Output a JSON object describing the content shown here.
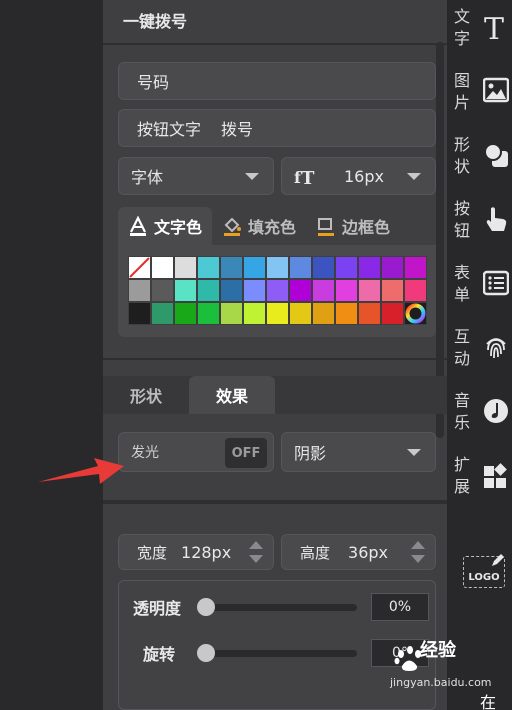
{
  "section": {
    "title": "一键拨号"
  },
  "phone_field": {
    "label": "号码"
  },
  "button_text": {
    "label": "按钮文字",
    "value": "拨号"
  },
  "font_select": {
    "value": "字体"
  },
  "font_size": {
    "value": "16px"
  },
  "color_tabs": [
    {
      "label": "文字色",
      "icon": "text-color-icon",
      "active": true
    },
    {
      "label": "填充色",
      "icon": "fill-bucket-icon",
      "active": false
    },
    {
      "label": "边框色",
      "icon": "border-color-icon",
      "active": false
    }
  ],
  "palette": [
    [
      "none",
      "#ffffff",
      "#dddddd",
      "#4cc9d2",
      "#3a87b8",
      "#35a5e6",
      "#82c4f2",
      "#5d8ae0",
      "#3c54c0",
      "#7a42f0",
      "#8a28e8",
      "#9a1ad0",
      "#c214c8"
    ],
    [
      "#9b9b9b",
      "#5a5a5a",
      "#5ae2c4",
      "#2fb9a8",
      "#2c6fa6",
      "#7b8cff",
      "#8f5cf5",
      "#b000d8",
      "#c93ce0",
      "#e23fe0",
      "#ee6aa8",
      "#ee6c6c",
      "#f03a7c"
    ],
    [
      "#1e1e1e",
      "#2e9a6a",
      "#18a818",
      "#1cbf3c",
      "#a8d848",
      "#bef232",
      "#e8ec1c",
      "#e4c816",
      "#e0a014",
      "#ef8e12",
      "#e8542a",
      "#d8202a",
      "more"
    ]
  ],
  "sub_tabs": [
    {
      "label": "形状",
      "active": false
    },
    {
      "label": "效果",
      "active": true
    }
  ],
  "glow": {
    "label": "发光",
    "toggle": "OFF"
  },
  "shadow_select": {
    "value": "阴影"
  },
  "width": {
    "label": "宽度",
    "value": "128px"
  },
  "height": {
    "label": "高度",
    "value": "36px"
  },
  "opacity": {
    "label": "透明度",
    "value": "0%",
    "level": 0
  },
  "rotation": {
    "label": "旋转",
    "value": "0°",
    "level": 0
  },
  "right_bar": [
    {
      "label": "文字",
      "icon": "text-t-icon"
    },
    {
      "label": "图片",
      "icon": "image-icon"
    },
    {
      "label": "形状",
      "icon": "shapes-icon"
    },
    {
      "label": "按钮",
      "icon": "pointer-hand-icon"
    },
    {
      "label": "表单",
      "icon": "form-list-icon"
    },
    {
      "label": "互动",
      "icon": "fingerprint-icon"
    },
    {
      "label": "音乐",
      "icon": "music-note-icon"
    },
    {
      "label": "扩展",
      "icon": "extension-grid-icon"
    }
  ],
  "logo_button": {
    "label": "LOGO"
  },
  "watermark": {
    "text": "经验",
    "sub": "jingyan.baidu.com",
    "char": "在"
  }
}
